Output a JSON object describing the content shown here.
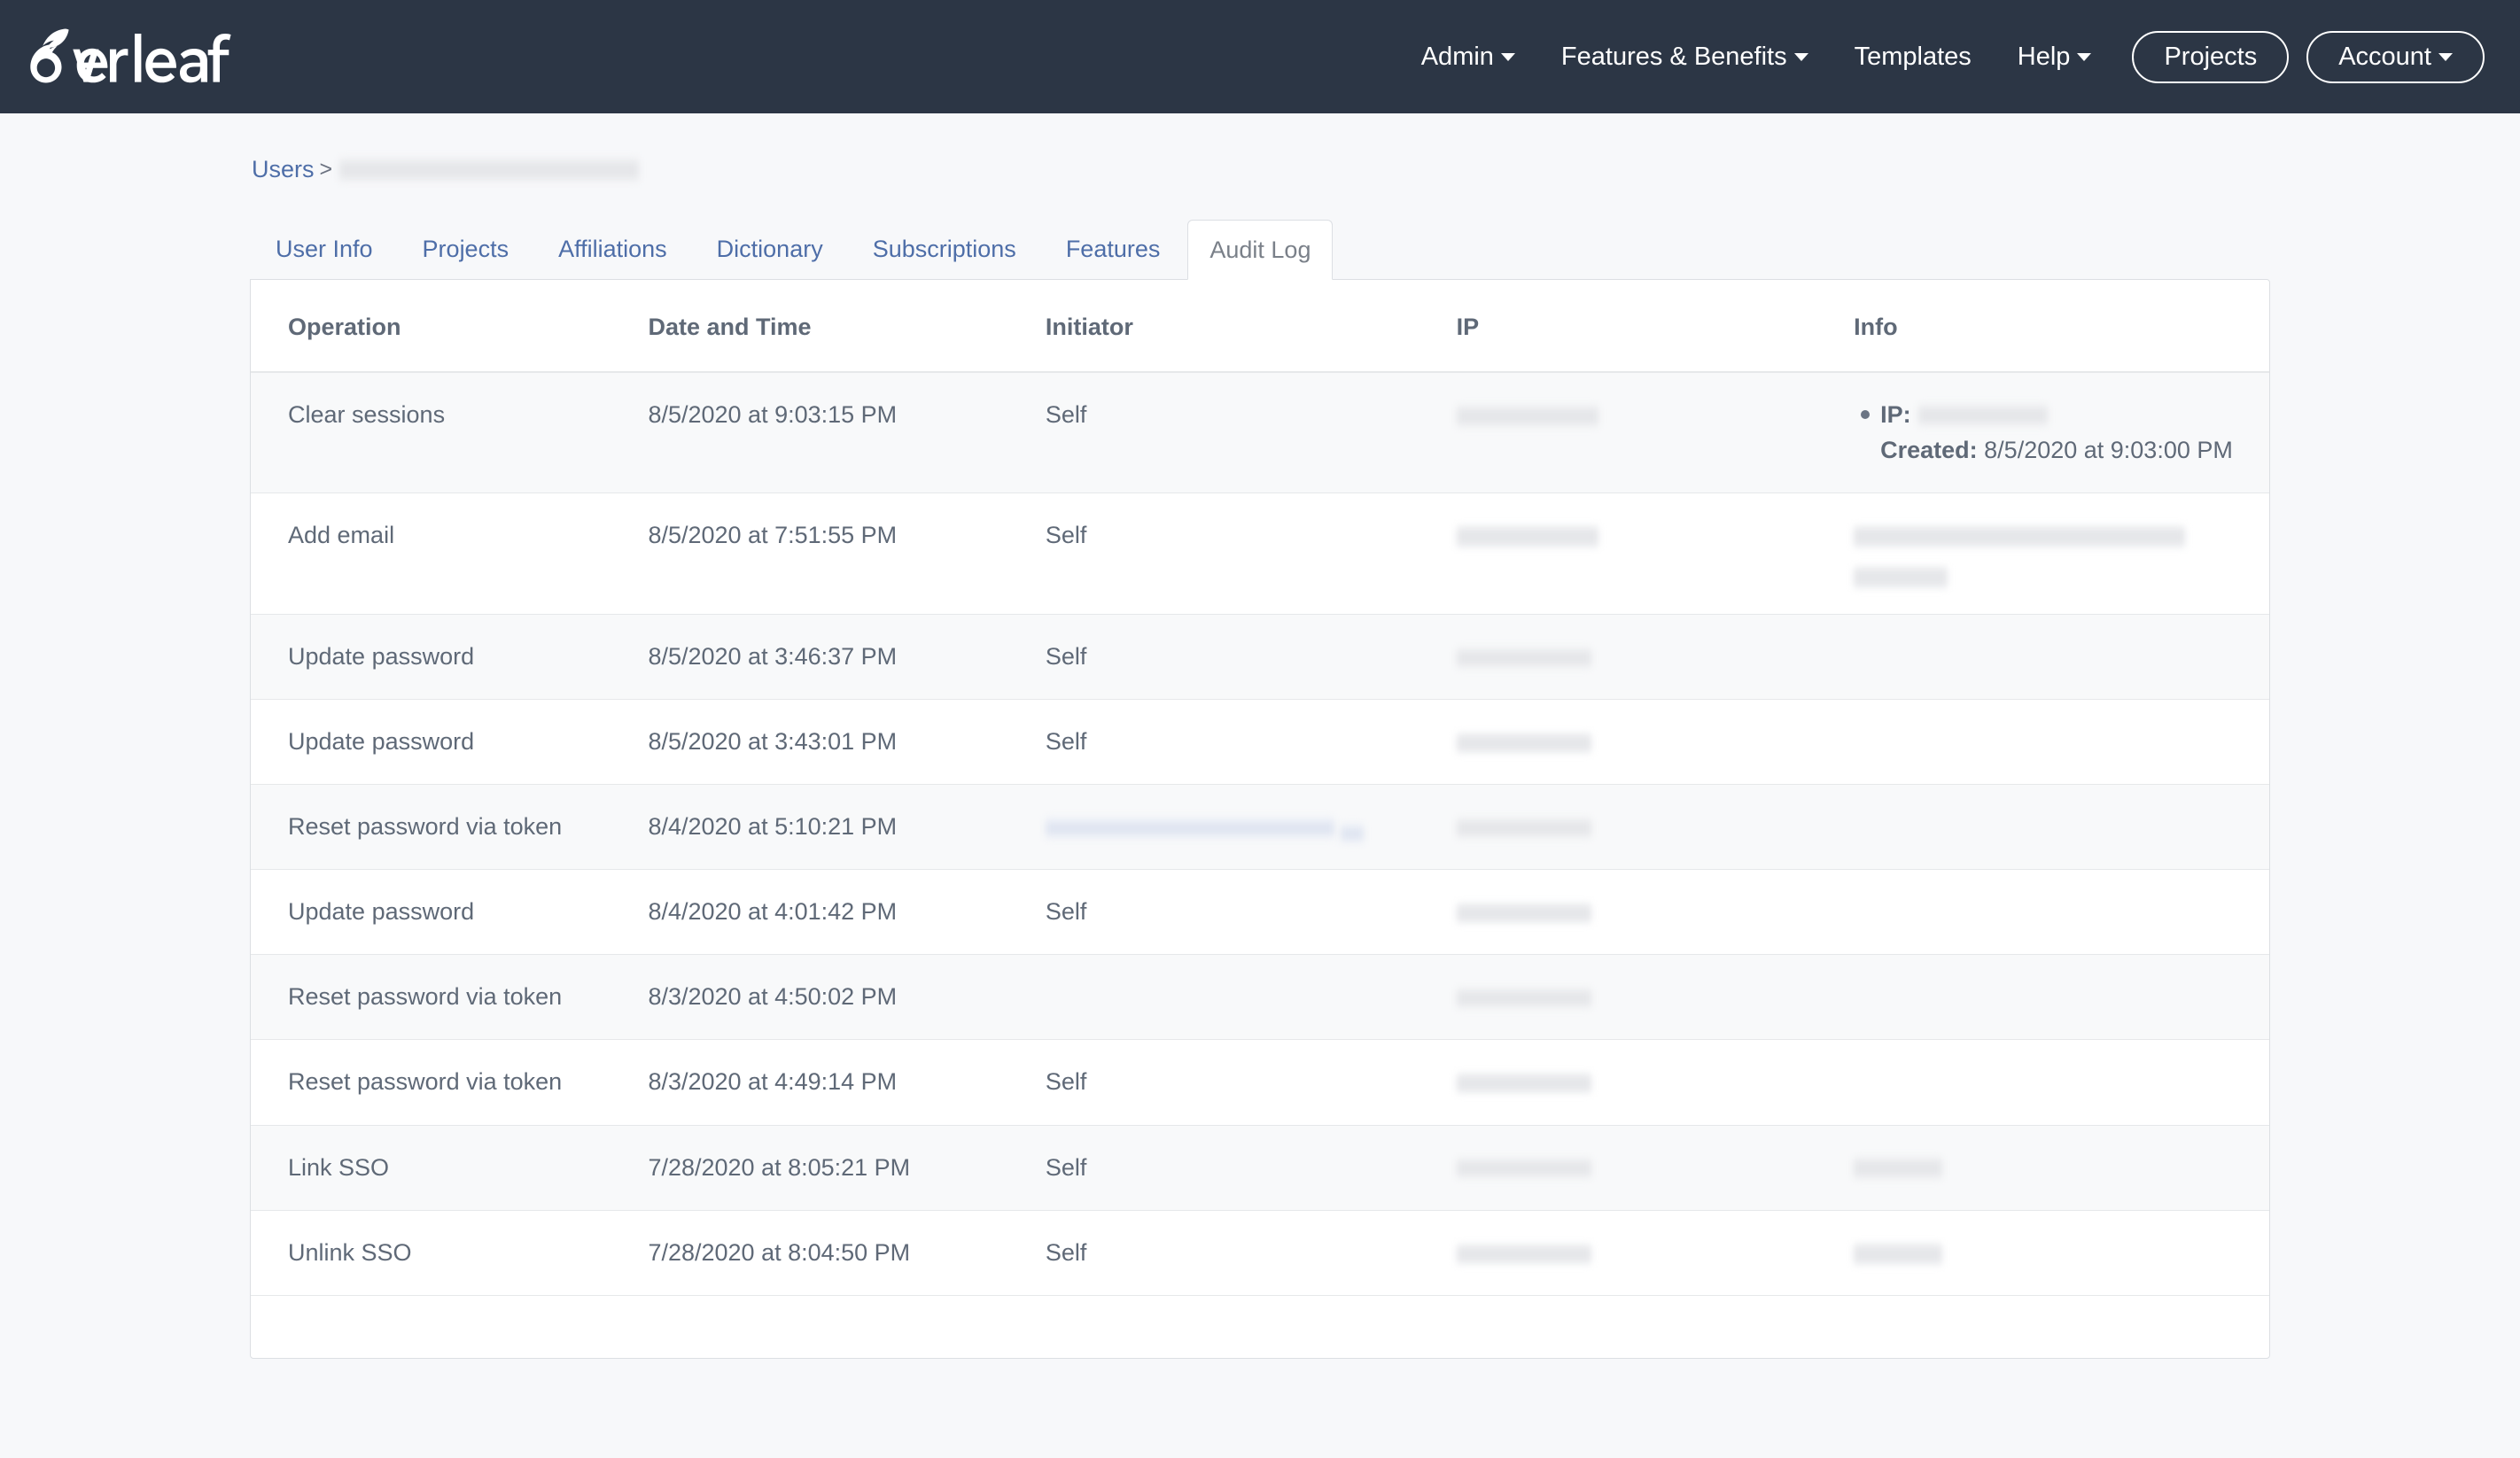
{
  "navbar": {
    "brand_label": "Overleaf",
    "links": [
      {
        "label": "Admin",
        "caret": true
      },
      {
        "label": "Features & Benefits",
        "caret": true
      },
      {
        "label": "Templates",
        "caret": false
      },
      {
        "label": "Help",
        "caret": true
      }
    ],
    "buttons": [
      {
        "label": "Projects",
        "caret": false
      },
      {
        "label": "Account",
        "caret": true
      }
    ]
  },
  "breadcrumb": {
    "root_label": "Users",
    "separator": ">",
    "current_label": ""
  },
  "tabs": [
    {
      "label": "User Info",
      "active": false
    },
    {
      "label": "Projects",
      "active": false
    },
    {
      "label": "Affiliations",
      "active": false
    },
    {
      "label": "Dictionary",
      "active": false
    },
    {
      "label": "Subscriptions",
      "active": false
    },
    {
      "label": "Features",
      "active": false
    },
    {
      "label": "Audit Log",
      "active": true
    }
  ],
  "table": {
    "columns": [
      "Operation",
      "Date and Time",
      "Initiator",
      "IP",
      "Info"
    ],
    "rows": [
      {
        "operation": "Clear sessions",
        "datetime": "8/5/2020 at 9:03:15 PM",
        "initiator": "Self",
        "ip": "",
        "info": {
          "ip_key": "IP:",
          "ip_value": "",
          "created_key": "Created:",
          "created_value": "8/5/2020 at 9:03:00 PM"
        }
      },
      {
        "operation": "Add email",
        "datetime": "8/5/2020 at 7:51:55 PM",
        "initiator": "Self",
        "ip": "",
        "info": null
      },
      {
        "operation": "Update password",
        "datetime": "8/5/2020 at 3:46:37 PM",
        "initiator": "Self",
        "ip": "",
        "info": null
      },
      {
        "operation": "Update password",
        "datetime": "8/5/2020 at 3:43:01 PM",
        "initiator": "Self",
        "ip": "",
        "info": null
      },
      {
        "operation": "Reset password via token",
        "datetime": "8/4/2020 at 5:10:21 PM",
        "initiator": "",
        "ip": "",
        "info": null
      },
      {
        "operation": "Update password",
        "datetime": "8/4/2020 at 4:01:42 PM",
        "initiator": "Self",
        "ip": "",
        "info": null
      },
      {
        "operation": "Reset password via token",
        "datetime": "8/3/2020 at 4:50:02 PM",
        "initiator": "",
        "ip": "",
        "info": null
      },
      {
        "operation": "Reset password via token",
        "datetime": "8/3/2020 at 4:49:14 PM",
        "initiator": "Self",
        "ip": "",
        "info": null
      },
      {
        "operation": "Link SSO",
        "datetime": "7/28/2020 at 8:05:21 PM",
        "initiator": "Self",
        "ip": "",
        "info": null
      },
      {
        "operation": "Unlink SSO",
        "datetime": "7/28/2020 at 8:04:50 PM",
        "initiator": "Self",
        "ip": "",
        "info": null
      }
    ]
  },
  "colors": {
    "navbar_bg": "#2c3645",
    "link_blue": "#4e6ea8",
    "page_bg": "#f7f8fa",
    "text": "#5f6977",
    "border": "#dcdfe3",
    "stripe": "#f8f9fa"
  }
}
